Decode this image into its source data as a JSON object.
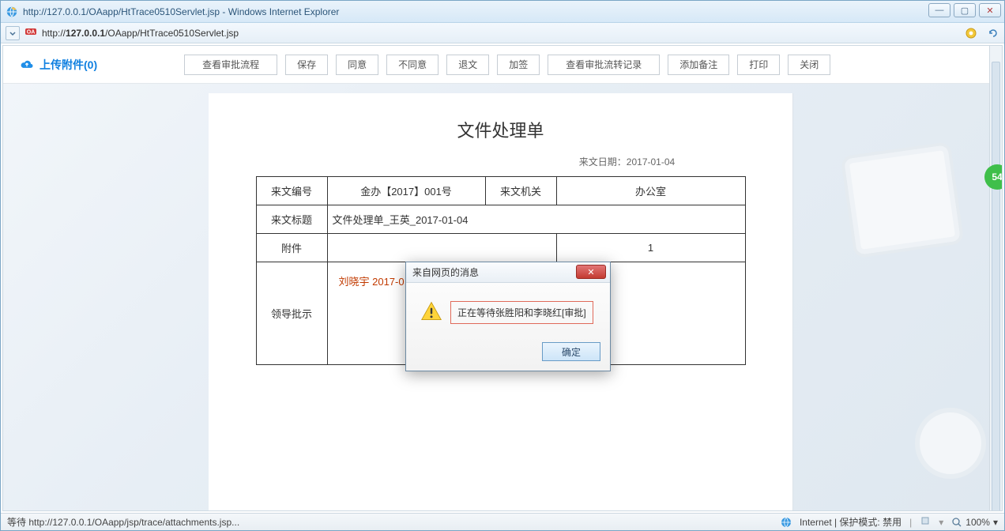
{
  "window": {
    "title": "http://127.0.0.1/OAapp/HtTrace0510Servlet.jsp - Windows Internet Explorer",
    "min": "—",
    "max": "▢",
    "close": "✕"
  },
  "address": {
    "url_prefix": "http://",
    "url_host": "127.0.0.1",
    "url_path": "/OAapp/HtTrace0510Servlet.jsp"
  },
  "badge": "54",
  "upload": {
    "label": "上传附件(0)"
  },
  "toolbar": {
    "view_flow": "查看审批流程",
    "save": "保存",
    "agree": "同意",
    "disagree": "不同意",
    "return": "退文",
    "addsign": "加签",
    "view_history": "查看审批流转记录",
    "add_note": "添加备注",
    "print": "打印",
    "close": "关闭"
  },
  "doc": {
    "title": "文件处理单",
    "date_label": "来文日期：2017-01-04",
    "row1": {
      "num_label": "来文编号",
      "num_value": "金办【2017】001号",
      "org_label": "来文机关",
      "org_value": "办公室"
    },
    "row2": {
      "title_label": "来文标题",
      "title_value": "文件处理单_王英_2017-01-04"
    },
    "row3": {
      "attach_label": "附件",
      "count": "1"
    },
    "row4": {
      "approve_label": "领导批示",
      "approve_value": "刘晓宇  2017-0"
    }
  },
  "modal": {
    "title": "来自网页的消息",
    "message": "正在等待张胜阳和李晓红[审批]",
    "ok": "确定",
    "close": "✕"
  },
  "status": {
    "left": "等待 http://127.0.0.1/OAapp/jsp/trace/attachments.jsp...",
    "zone": "Internet | 保护模式: 禁用",
    "zoom": "100%"
  }
}
